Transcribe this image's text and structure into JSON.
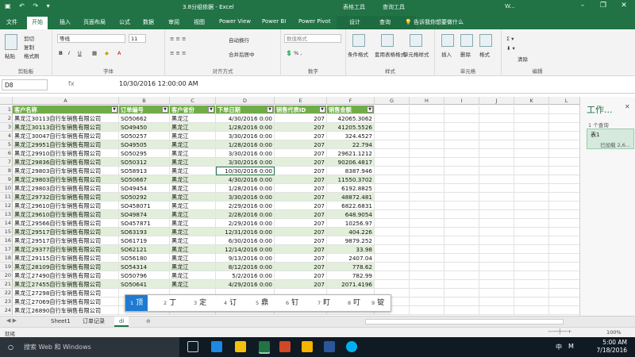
{
  "window": {
    "title": "3.8分组依据 - Excel",
    "context_tab_group_1": "表格工具",
    "context_tab_group_2": "查询工具",
    "user": "W...",
    "min": "–",
    "restore": "❐",
    "close": "✕"
  },
  "tabs": [
    "文件",
    "开始",
    "插入",
    "页面布局",
    "公式",
    "数据",
    "审阅",
    "视图",
    "Power View",
    "Power BI",
    "Power Pivot",
    "设计",
    "查询"
  ],
  "tell_me": "告诉我你想要做什么",
  "ribbon": {
    "clipboard": {
      "label": "剪贴板",
      "paste": "粘贴",
      "cut": "剪切",
      "copy": "复制",
      "format_painter": "格式刷"
    },
    "font": {
      "label": "字体",
      "name": "等线",
      "size": "11"
    },
    "alignment": {
      "label": "对齐方式",
      "wrap": "自动换行",
      "merge": "合并后居中"
    },
    "number": {
      "label": "数字",
      "format": "数值格式"
    },
    "styles": {
      "label": "样式",
      "conditional": "条件格式",
      "as_table": "套用表格格式",
      "cell_styles": "单元格样式"
    },
    "cells": {
      "label": "单元格",
      "insert": "插入",
      "delete": "删除",
      "format": "格式"
    },
    "editing": {
      "label": "编辑",
      "clear": "清除"
    }
  },
  "formula_bar": {
    "name_box": "D8",
    "fx": "fx",
    "value": "10/30/2016  12:00:00 AM"
  },
  "columns": [
    "A",
    "B",
    "C",
    "D",
    "E",
    "F",
    "G",
    "H",
    "I",
    "J",
    "K",
    "L"
  ],
  "header_row": [
    "客户名称",
    "订单编号",
    "客户省份",
    "下单日期",
    "销售代表ID",
    "销售金额"
  ],
  "rows": [
    [
      "黑龙江30113自行车销售有限公司",
      "SO50662",
      "黑龙江",
      "4/30/2016 0:00",
      "207",
      "42065.3062"
    ],
    [
      "黑龙江30113自行车销售有限公司",
      "SO49450",
      "黑龙江",
      "1/28/2016 0:00",
      "207",
      "41205.5526"
    ],
    [
      "黑龙江30047自行车销售有限公司",
      "SO50257",
      "黑龙江",
      "3/30/2016 0:00",
      "207",
      "324.4527"
    ],
    [
      "黑龙江29951自行车销售有限公司",
      "SO49505",
      "黑龙江",
      "1/28/2016 0:00",
      "207",
      "22.794"
    ],
    [
      "黑龙江29910自行车销售有限公司",
      "SO50295",
      "黑龙江",
      "3/30/2016 0:00",
      "207",
      "29621.1212"
    ],
    [
      "黑龙江29836自行车销售有限公司",
      "SO50312",
      "黑龙江",
      "3/30/2016 0:00",
      "207",
      "90206.4817"
    ],
    [
      "黑龙江29803自行车销售有限公司",
      "SO58913",
      "黑龙江",
      "10/30/2016 0:00",
      "207",
      "8387.946"
    ],
    [
      "黑龙江29803自行车销售有限公司",
      "SO50667",
      "黑龙江",
      "4/30/2016 0:00",
      "207",
      "11550.3702"
    ],
    [
      "黑龙江29803自行车销售有限公司",
      "SO49454",
      "黑龙江",
      "1/28/2016 0:00",
      "207",
      "6192.8825"
    ],
    [
      "黑龙江29732自行车销售有限公司",
      "SO50292",
      "黑龙江",
      "3/30/2016 0:00",
      "207",
      "48872.481"
    ],
    [
      "黑龙江29610自行车销售有限公司",
      "SO458071",
      "黑龙江",
      "2/29/2016 0:00",
      "207",
      "6822.6831"
    ],
    [
      "黑龙江29610自行车销售有限公司",
      "SO49874",
      "黑龙江",
      "2/28/2016 0:00",
      "207",
      "648.9054"
    ],
    [
      "黑龙江29566自行车销售有限公司",
      "SO457871",
      "黑龙江",
      "2/29/2016 0:00",
      "207",
      "10256.97"
    ],
    [
      "黑龙江29517自行车销售有限公司",
      "SO63193",
      "黑龙江",
      "12/31/2016 0:00",
      "207",
      "404.226"
    ],
    [
      "黑龙江29517自行车销售有限公司",
      "SO61719",
      "黑龙江",
      "6/30/2016 0:00",
      "207",
      "9879.252"
    ],
    [
      "黑龙江29377自行车销售有限公司",
      "SO62121",
      "黑龙江",
      "12/14/2016 0:00",
      "207",
      "33.98"
    ],
    [
      "黑龙江29115自行车销售有限公司",
      "SO56180",
      "黑龙江",
      "9/13/2016 0:00",
      "207",
      "2407.04"
    ],
    [
      "黑龙江28109自行车销售有限公司",
      "SO54314",
      "黑龙江",
      "8/12/2016 0:00",
      "207",
      "778.62"
    ],
    [
      "黑龙江27490自行车销售有限公司",
      "SO50796",
      "黑龙江",
      "5/2/2016 0:00",
      "207",
      "782.99"
    ],
    [
      "黑龙江27455自行车销售有限公司",
      "SO50641",
      "黑龙江",
      "4/29/2016 0:00",
      "207",
      "2071.4196"
    ],
    [
      "黑龙江27298自行车销售有限公司",
      "",
      "",
      "",
      "",
      ""
    ],
    [
      "黑龙江27069自行车销售有限公司",
      "",
      "",
      "",
      "",
      ""
    ],
    [
      "黑龙江26890自行车销售有限公司",
      "",
      "",
      "",
      "",
      ""
    ]
  ],
  "ime": {
    "candidates": [
      [
        "1",
        "顶"
      ],
      [
        "2",
        "丁"
      ],
      [
        "3",
        "定"
      ],
      [
        "4",
        "订"
      ],
      [
        "5",
        "鼎"
      ],
      [
        "6",
        "钉"
      ],
      [
        "7",
        "盯"
      ],
      [
        "8",
        "叮"
      ],
      [
        "9",
        "锭"
      ]
    ]
  },
  "pane": {
    "title": "工作...",
    "count": "1 个查询",
    "query": "表1",
    "loaded": "已加载 2,6..."
  },
  "sheets": [
    "Sheet1",
    "订单记录",
    "di"
  ],
  "add_sheet": "⊕",
  "status": {
    "ready": "就绪",
    "zoom": "100%"
  },
  "taskbar": {
    "search": "搜索 Web 和 Windows",
    "time": "5:00 AM",
    "date": "7/18/2016",
    "lang": "中",
    "lang2": "M"
  },
  "colors": {
    "excel_green": "#217346",
    "header_green": "#70ad47",
    "band": "#e2efda"
  }
}
